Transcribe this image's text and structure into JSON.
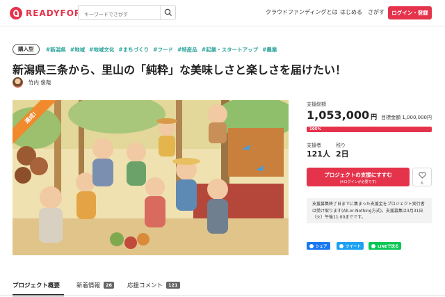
{
  "header": {
    "logo_text": "READYFOR",
    "search_placeholder": "キーワードでさがす",
    "nav": [
      "クラウドファンディングとは",
      "はじめる",
      "さがす"
    ],
    "login_label": "ログイン・登録"
  },
  "project": {
    "type_badge": "購入型",
    "tags": [
      "#新潟県",
      "#地域",
      "#地域文化",
      "#まちづくり",
      "#フード",
      "#特産品",
      "#起業・スタートアップ",
      "#農業"
    ],
    "title": "新潟県三条から、里山の「純粋」な美味しさと楽しさを届けたい！",
    "owner_name": "竹内 俊哉",
    "ribbon": "達成！"
  },
  "stats": {
    "total_label": "支援総額",
    "total_amount": "1,053,000",
    "total_unit": "円",
    "target_text": "目標金額 1,000,000円",
    "progress_label": "105%",
    "progress_percent": 105,
    "supporters_label": "支援者",
    "supporters_value": "121人",
    "remaining_label": "残り",
    "remaining_value": "2日"
  },
  "actions": {
    "support_main": "プロジェクトの支援にすすむ",
    "support_sub": "(※ログインが必要です)",
    "favorite_count": "6",
    "note": "支援募集終了日までに集まった支援金をプロジェクト実行者は受け取ります(All-or-Nothing方式)。支援募集は3月31日（火）午後11:00までです。",
    "share": [
      {
        "label": "シェア",
        "color": "#1877f2"
      },
      {
        "label": "ツイート",
        "color": "#1da1f2"
      },
      {
        "label": "LINEで送る",
        "color": "#06c755"
      }
    ]
  },
  "tabs": [
    {
      "label": "プロジェクト概要",
      "badge": ""
    },
    {
      "label": "新着情報",
      "badge": "26"
    },
    {
      "label": "応援コメント",
      "badge": "121"
    }
  ],
  "colors": {
    "brand": "#e5334b",
    "tag": "#2aa39a",
    "ribbon": "#f08a2c"
  }
}
